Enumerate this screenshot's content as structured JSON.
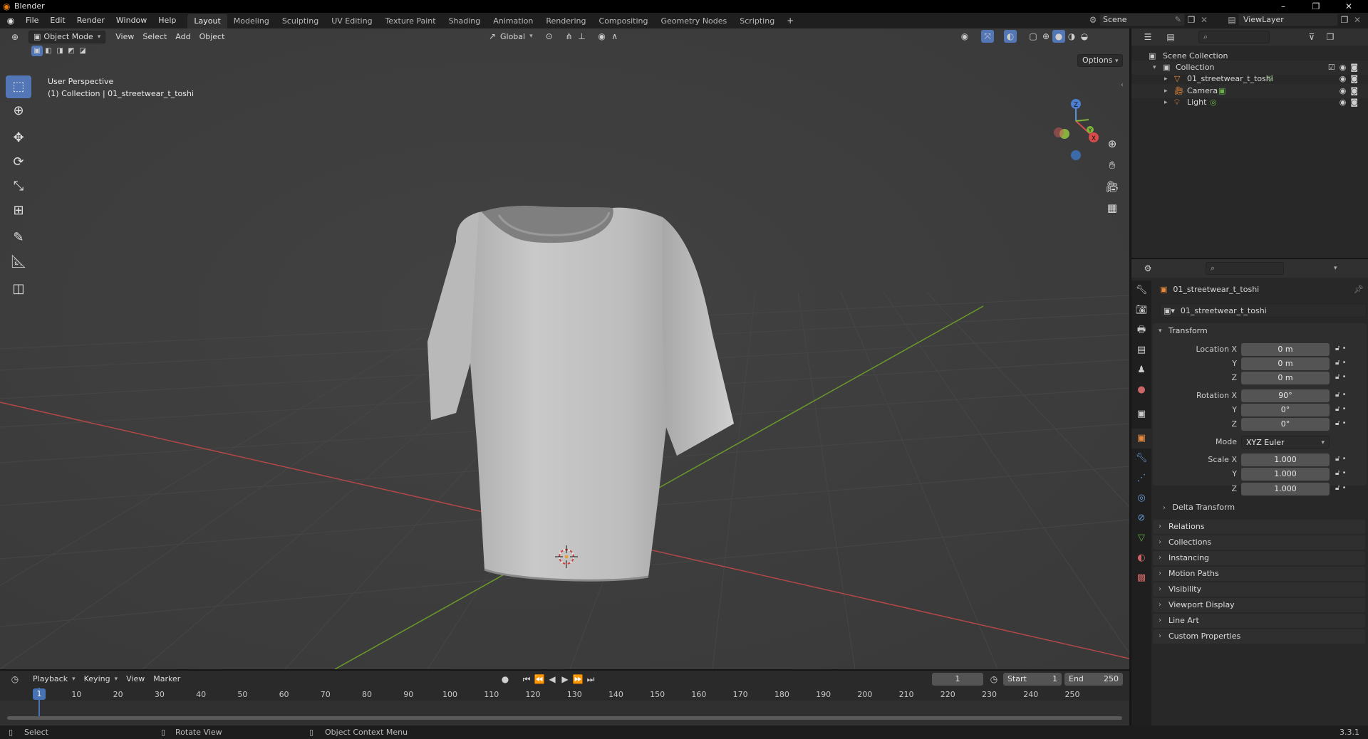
{
  "app": {
    "title": "Blender",
    "version": "3.3.1"
  },
  "menu": [
    "File",
    "Edit",
    "Render",
    "Window",
    "Help"
  ],
  "workspaces": [
    "Layout",
    "Modeling",
    "Sculpting",
    "UV Editing",
    "Texture Paint",
    "Shading",
    "Animation",
    "Rendering",
    "Compositing",
    "Geometry Nodes",
    "Scripting"
  ],
  "active_workspace": "Layout",
  "scene": {
    "scene_name": "Scene",
    "view_layer": "ViewLayer"
  },
  "viewport": {
    "mode": "Object Mode",
    "menus": [
      "View",
      "Select",
      "Add",
      "Object"
    ],
    "orientation": "Global",
    "options_label": "Options",
    "perspective_label": "User Perspective",
    "collection_label": "(1) Collection | 01_streetwear_t_toshi",
    "colors": {
      "x_axis": "#b44747",
      "y_axis": "#6a9a2a",
      "active_tool": "#5377b6"
    }
  },
  "outliner": {
    "root": "Scene Collection",
    "collection": "Collection",
    "items": [
      {
        "name": "01_streetwear_t_toshi",
        "icon": "mesh-icon"
      },
      {
        "name": "Camera",
        "icon": "camera-icon"
      },
      {
        "name": "Light",
        "icon": "light-icon"
      }
    ]
  },
  "properties": {
    "object_name": "01_streetwear_t_toshi",
    "data_name": "01_streetwear_t_toshi",
    "transform_label": "Transform",
    "location": {
      "label": "Location X",
      "x": "0 m",
      "y": "0 m",
      "z": "0 m"
    },
    "rotation": {
      "label": "Rotation X",
      "x": "90°",
      "y": "0°",
      "z": "0°"
    },
    "mode": {
      "label": "Mode",
      "value": "XYZ Euler"
    },
    "scale": {
      "label": "Scale X",
      "x": "1.000",
      "y": "1.000",
      "z": "1.000"
    },
    "axis_y": "Y",
    "axis_z": "Z",
    "delta_transform": "Delta Transform",
    "panels": [
      "Relations",
      "Collections",
      "Instancing",
      "Motion Paths",
      "Visibility",
      "Viewport Display",
      "Line Art",
      "Custom Properties"
    ]
  },
  "timeline": {
    "menus": [
      "Playback",
      "Keying",
      "View",
      "Marker"
    ],
    "current_frame": "1",
    "start_label": "Start",
    "start": "1",
    "end_label": "End",
    "end": "250",
    "ticks": [
      "1",
      "10",
      "20",
      "30",
      "40",
      "50",
      "60",
      "70",
      "80",
      "90",
      "100",
      "110",
      "120",
      "130",
      "140",
      "150",
      "160",
      "170",
      "180",
      "190",
      "200",
      "210",
      "220",
      "230",
      "240",
      "250"
    ]
  },
  "status": {
    "select": "Select",
    "rotate": "Rotate View",
    "context": "Object Context Menu"
  }
}
